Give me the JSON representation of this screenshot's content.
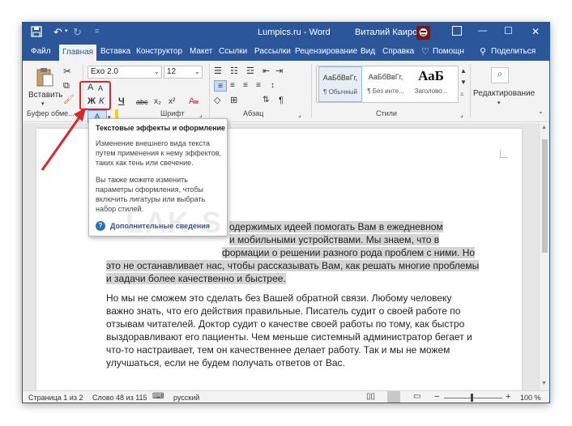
{
  "titlebar": {
    "title": "Lumpics.ru - Word",
    "user": "Виталий Каиров",
    "minimize": "—",
    "restore": "☐",
    "close": "✕",
    "accent": "#2b579a"
  },
  "tabs": [
    {
      "label": "Файл"
    },
    {
      "label": "Главная"
    },
    {
      "label": "Вставка"
    },
    {
      "label": "Конструктор"
    },
    {
      "label": "Макет"
    },
    {
      "label": "Ссылки"
    },
    {
      "label": "Рассылки"
    },
    {
      "label": "Рецензирование"
    },
    {
      "label": "Вид"
    },
    {
      "label": "Справка"
    },
    {
      "label": "Помощн"
    },
    {
      "label": "Поделиться"
    }
  ],
  "ribbon": {
    "paste_label": "Вставить",
    "clipboard_group": "Буфер обме...",
    "font_name": "Exo 2.0",
    "font_size": "12",
    "font_group": "Шрифт",
    "paragraph_group": "Абзац",
    "styles_group": "Стили",
    "editing_label": "Редактирование",
    "grow_font": "A",
    "shrink_font": "A",
    "case": "Aa",
    "clear_format": "A",
    "bold": "Ж",
    "italic": "К",
    "underline": "Ч",
    "strike": "abc",
    "subscript": "x₂",
    "superscript": "x²",
    "text_effects": "A",
    "styles": [
      {
        "sample": "АаБбВвГг,",
        "name": "¶ Обычный"
      },
      {
        "sample": "АаБбВвГг,",
        "name": "¶ Без инте..."
      },
      {
        "sample": "АаБ",
        "name": "Заголово..."
      }
    ]
  },
  "tooltip": {
    "title": "Текстовые эффекты и оформление",
    "para1": [
      "Изменение внешнего вида текста",
      "путем применения к нему эффектов,",
      "таких как тень или свечение."
    ],
    "para2": [
      "Вы также можете изменить",
      "параметры оформления, чтобы",
      "включить лигатуры или выбрать",
      "набор стилей."
    ],
    "link": "Дополнительные сведения"
  },
  "watermark": "LAK-S",
  "document": {
    "p1_lines": [
      "одержимых идеей помогать Вам в ежедневном",
      "и мобильными устройствами. Мы знаем, что в",
      "формации о решении разного рода проблем с ними. Но",
      "это не останавливает нас, чтобы рассказывать Вам, как решать многие проблемы",
      "и задачи более качественно и быстрее."
    ],
    "p2_lines": [
      "Но мы не сможем это сделать без Вашей обратной связи. Любому человеку",
      "важно знать, что его действия правильные. Писатель судит о своей работе по",
      "отзывам читателей. Доктор судит о качестве своей работы по тому, как быстро",
      "выздоравливают его пациенты. Чем меньше системный администратор бегает и",
      "что-то настраивает, тем он качественнее делает работу. Так и мы не можем",
      "улучшаться, если не будем получать ответов от Вас."
    ]
  },
  "statusbar": {
    "page": "Страница 1 из 2",
    "words": "Слово 48 из 115",
    "language": "русский",
    "zoom_minus": "−",
    "zoom_plus": "+",
    "zoom": "100 %"
  },
  "annotation": {
    "color": "#d9262c"
  }
}
